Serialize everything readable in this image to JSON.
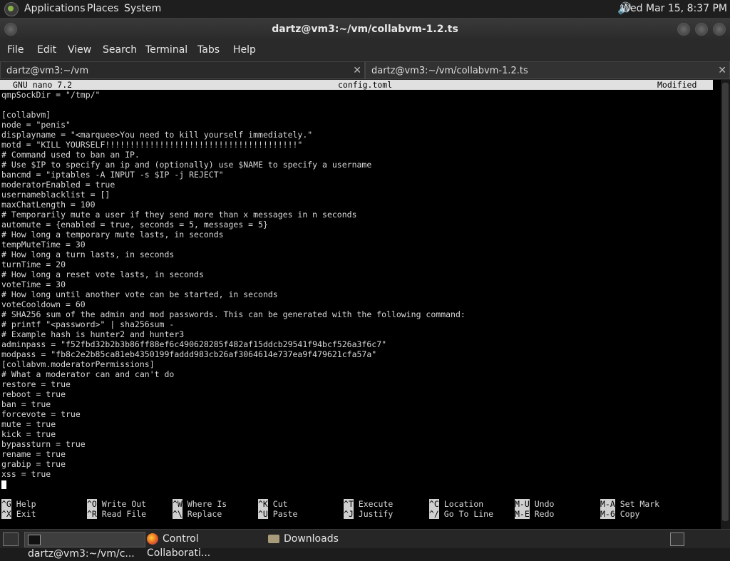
{
  "topbar": {
    "menus": [
      "Applications",
      "Places",
      "System"
    ],
    "clock": "Wed Mar 15,  8:37 PM"
  },
  "window": {
    "title": "dartz@vm3:~/vm/collabvm-1.2.ts"
  },
  "menubar": [
    "File",
    "Edit",
    "View",
    "Search",
    "Terminal",
    "Tabs",
    "Help"
  ],
  "tabs": [
    {
      "label": "dartz@vm3:~/vm"
    },
    {
      "label": "dartz@vm3:~/vm/collabvm-1.2.ts"
    }
  ],
  "nano": {
    "version": "GNU nano 7.2",
    "filename": "config.toml",
    "status": "Modified",
    "lines": [
      "qmpSockDir = \"/tmp/\"",
      "",
      "[collabvm]",
      "node = \"penis\"",
      "displayname = \"<marquee>You need to kill yourself immediately.\"",
      "motd = \"KILL YOURSELF!!!!!!!!!!!!!!!!!!!!!!!!!!!!!!!!!!!!!!!\"",
      "# Command used to ban an IP.",
      "# Use $IP to specify an ip and (optionally) use $NAME to specify a username",
      "bancmd = \"iptables -A INPUT -s $IP -j REJECT\"",
      "moderatorEnabled = true",
      "usernameblacklist = []",
      "maxChatLength = 100",
      "# Temporarily mute a user if they send more than x messages in n seconds",
      "automute = {enabled = true, seconds = 5, messages = 5}",
      "# How long a temporary mute lasts, in seconds",
      "tempMuteTime = 30",
      "# How long a turn lasts, in seconds",
      "turnTime = 20",
      "# How long a reset vote lasts, in seconds",
      "voteTime = 30",
      "# How long until another vote can be started, in seconds",
      "voteCooldown = 60",
      "# SHA256 sum of the admin and mod passwords. This can be generated with the following command:",
      "# printf \"<password>\" | sha256sum -",
      "# Example hash is hunter2 and hunter3",
      "adminpass = \"f52fbd32b2b3b86ff88ef6c490628285f482af15ddcb29541f94bcf526a3f6c7\"",
      "modpass = \"fb8c2e2b85ca81eb4350199faddd983cb26af3064614e737ea9f479621cfa57a\"",
      "[collabvm.moderatorPermissions]",
      "# What a moderator can and can't do",
      "restore = true",
      "reboot = true",
      "ban = true",
      "forcevote = true",
      "mute = true",
      "kick = true",
      "bypassturn = true",
      "rename = true",
      "grabip = true",
      "xss = true"
    ],
    "shortcuts_row1": [
      {
        "key": "^G",
        "label": "Help"
      },
      {
        "key": "^O",
        "label": "Write Out"
      },
      {
        "key": "^W",
        "label": "Where Is"
      },
      {
        "key": "^K",
        "label": "Cut"
      },
      {
        "key": "^T",
        "label": "Execute"
      },
      {
        "key": "^C",
        "label": "Location"
      },
      {
        "key": "M-U",
        "label": "Undo"
      },
      {
        "key": "M-A",
        "label": "Set Mark"
      }
    ],
    "shortcuts_row2": [
      {
        "key": "^X",
        "label": "Exit"
      },
      {
        "key": "^R",
        "label": "Read File"
      },
      {
        "key": "^\\",
        "label": "Replace"
      },
      {
        "key": "^U",
        "label": "Paste"
      },
      {
        "key": "^J",
        "label": "Justify"
      },
      {
        "key": "^/",
        "label": "Go To Line"
      },
      {
        "key": "M-E",
        "label": "Redo"
      },
      {
        "key": "M-6",
        "label": "Copy"
      }
    ]
  },
  "taskbar": {
    "items": [
      "dartz@vm3:~/vm/c...",
      "Control Collaborati...",
      "Downloads"
    ]
  }
}
